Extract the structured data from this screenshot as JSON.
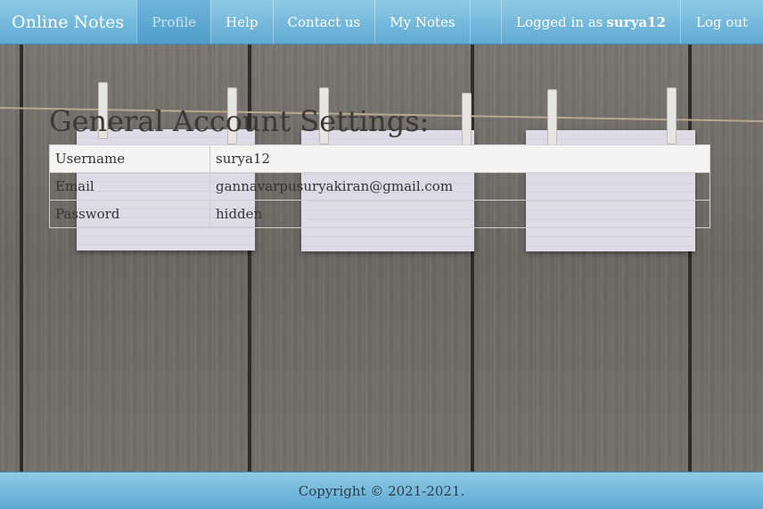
{
  "navbar": {
    "brand": "Online Notes",
    "items": [
      {
        "label": "Profile",
        "active": true
      },
      {
        "label": "Help"
      },
      {
        "label": "Contact us"
      },
      {
        "label": "My Notes"
      }
    ],
    "logged_in_prefix": "Logged in as",
    "username": "surya12",
    "logout": "Log out"
  },
  "main": {
    "title": "General Account Settings:",
    "rows": [
      {
        "label": "Username",
        "value": "surya12"
      },
      {
        "label": "Email",
        "value": "gannavarpusuryakiran@gmail.com"
      },
      {
        "label": "Password",
        "value": "hidden"
      }
    ]
  },
  "footer": {
    "copyright": "Copyright © 2021-2021."
  },
  "colors": {
    "navbar": "#6fb6dc",
    "active_tab": "#4f9dc9",
    "text_dark": "#3b3836"
  }
}
